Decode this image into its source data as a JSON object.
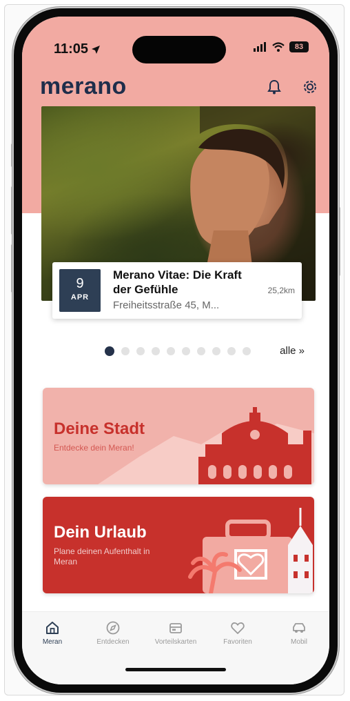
{
  "status_bar": {
    "time": "11:05",
    "battery": "83"
  },
  "header": {
    "logo": "merano",
    "bell_icon": "bell-icon",
    "settings_icon": "gear-icon"
  },
  "event": {
    "day": "9",
    "month": "APR",
    "title": "Merano Vitae: Die Kraft der Gefühle",
    "address": "Freiheitsstraße 45, M...",
    "distance": "25,2km"
  },
  "pager": {
    "count": 10,
    "active": 0,
    "all_label": "alle »"
  },
  "cards": [
    {
      "title": "Deine Stadt",
      "subtitle": "Entdecke dein Meran!"
    },
    {
      "title": "Dein Urlaub",
      "subtitle": "Plane deinen Aufenthalt in Meran"
    }
  ],
  "tabs": [
    {
      "label": "Meran",
      "icon": "home-icon"
    },
    {
      "label": "Entdecken",
      "icon": "compass-icon"
    },
    {
      "label": "Vorteilskarten",
      "icon": "card-icon"
    },
    {
      "label": "Favoriten",
      "icon": "heart-icon"
    },
    {
      "label": "Mobil",
      "icon": "car-icon"
    }
  ],
  "colors": {
    "header_pink": "#f2aaa2",
    "navy": "#1f2e4b",
    "brand_red": "#c7312c",
    "light_pink_card": "#f1b2ab"
  }
}
